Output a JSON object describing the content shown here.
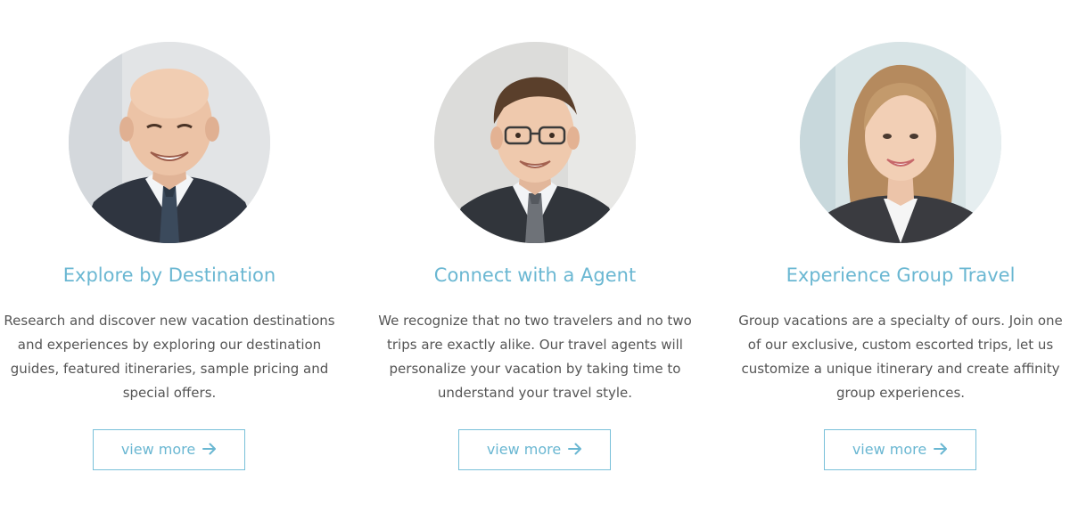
{
  "features": [
    {
      "title": "Explore by Destination",
      "description": "Research and discover new vacation destinations and experiences by exploring our destination guides, featured itineraries, sample pricing and special offers.",
      "button_label": "view more",
      "button_icon": "arrow-right-icon",
      "photo": "smiling bald man in a dark suit with a patterned tie"
    },
    {
      "title": "Connect with a Agent",
      "description": "We recognize that no two travelers and no two trips are exactly alike. Our travel agents will personalize your vacation by taking time to understand your travel style.",
      "button_label": "view more",
      "button_icon": "arrow-right-icon",
      "photo": "young man with glasses in a dark suit and striped tie"
    },
    {
      "title": "Experience Group Travel",
      "description": "Group vacations are a specialty of ours. Join one of our exclusive, custom escorted trips, let us customize a unique itinerary and create affinity group experiences.",
      "button_label": "view more",
      "button_icon": "arrow-right-icon",
      "photo": "smiling woman with long light-brown hair in a dark blazer"
    }
  ],
  "colors": {
    "accent": "#6ab7d2",
    "button_border": "#79c0d9",
    "body_text": "#555555",
    "background": "#ffffff"
  }
}
